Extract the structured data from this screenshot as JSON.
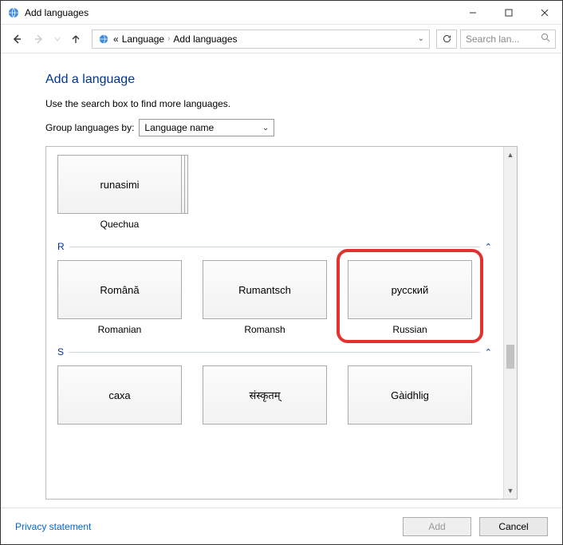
{
  "window": {
    "title": "Add languages"
  },
  "nav": {
    "breadcrumb": {
      "ellipsis": "«",
      "item1": "Language",
      "item2": "Add languages"
    },
    "search_placeholder": "Search lan..."
  },
  "page": {
    "heading": "Add a language",
    "instruction": "Use the search box to find more languages.",
    "group_label": "Group languages by:",
    "group_value": "Language name"
  },
  "groups": {
    "q": {
      "header": "",
      "tiles": [
        {
          "native": "runasimi",
          "english": "Quechua",
          "stacked": true
        }
      ]
    },
    "r": {
      "header": "R",
      "tiles": [
        {
          "native": "Română",
          "english": "Romanian"
        },
        {
          "native": "Rumantsch",
          "english": "Romansh"
        },
        {
          "native": "русский",
          "english": "Russian",
          "highlight": true
        }
      ]
    },
    "s": {
      "header": "S",
      "tiles": [
        {
          "native": "саха",
          "english": ""
        },
        {
          "native": "संस्कृतम्",
          "english": ""
        },
        {
          "native": "Gàidhlig",
          "english": ""
        }
      ]
    }
  },
  "footer": {
    "privacy": "Privacy statement",
    "add": "Add",
    "cancel": "Cancel"
  }
}
